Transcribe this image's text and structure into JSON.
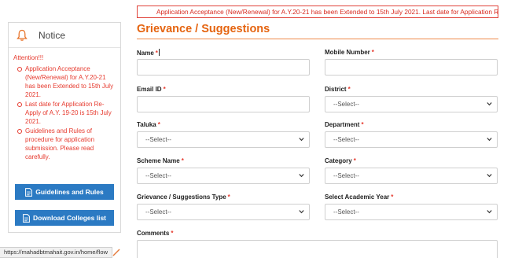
{
  "notice": {
    "title": "Notice",
    "icon": "bell-icon",
    "attention": "Attention!!!",
    "items": [
      "Application Acceptance (New/Renewal) for A.Y.20-21 has been Extended to 15th July 2021.",
      "Last date for Application Re-Apply of A.Y. 19-20 is 15th July 2021.",
      "Guidelines and Rules of procedure for application submission. Please read carefully."
    ],
    "guidelines_button": "Guidelines and Rules",
    "colleges_button": "Download Colleges list"
  },
  "marquee": {
    "text": "Application Acceptance (New/Renewal) for A.Y.20-21 has been Extended to 15th July 2021. Last date for Application Re-App"
  },
  "form": {
    "title": "Grievance / Suggestions",
    "required_marker": "*",
    "name": {
      "label": "Name"
    },
    "mobile": {
      "label": "Mobile Number"
    },
    "email": {
      "label": "Email ID"
    },
    "district": {
      "label": "District",
      "value": "--Select--"
    },
    "taluka": {
      "label": "Taluka",
      "value": "--Select--"
    },
    "department": {
      "label": "Department",
      "value": "--Select--"
    },
    "scheme": {
      "label": "Scheme Name",
      "value": "--Select--"
    },
    "category": {
      "label": "Category",
      "value": "--Select--"
    },
    "grievance_type": {
      "label": "Grievance / Suggestions Type",
      "value": "--Select--"
    },
    "academic_year": {
      "label": "Select Academic Year",
      "value": "--Select--"
    },
    "comments": {
      "label": "Comments"
    }
  },
  "status_bar": {
    "url": "https://mahadbtmahait.gov.in/home/flow"
  },
  "colors": {
    "accent_orange": "#e56410",
    "alert_red": "#e63a2e",
    "button_blue": "#2b7ac3"
  }
}
